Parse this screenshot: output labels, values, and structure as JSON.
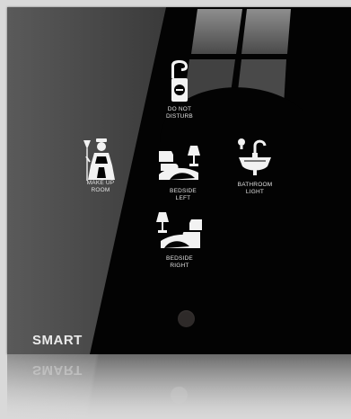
{
  "panel": {
    "brand": "SMART",
    "buttons": [
      {
        "id": "do-not-disturb",
        "label": "DO NOT\nDISTURB",
        "icon": "door-hanger-icon"
      },
      {
        "id": "make-up-room",
        "label": "MAKE UP\nROOM",
        "icon": "housekeeper-icon"
      },
      {
        "id": "bedside-left",
        "label": "BEDSIDE\nLEFT",
        "icon": "bed-lamp-left-icon"
      },
      {
        "id": "bathroom-light",
        "label": "BATHROOM\nLIGHT",
        "icon": "washbasin-bulb-icon"
      },
      {
        "id": "bedside-right",
        "label": "BEDSIDE\nRIGHT",
        "icon": "bed-lamp-right-icon"
      }
    ],
    "indicator": "led-dot"
  },
  "colors": {
    "panel": "#030303",
    "icon": "#f2f2f2",
    "label": "#e2e2e2",
    "background": "#d9d9d9"
  }
}
